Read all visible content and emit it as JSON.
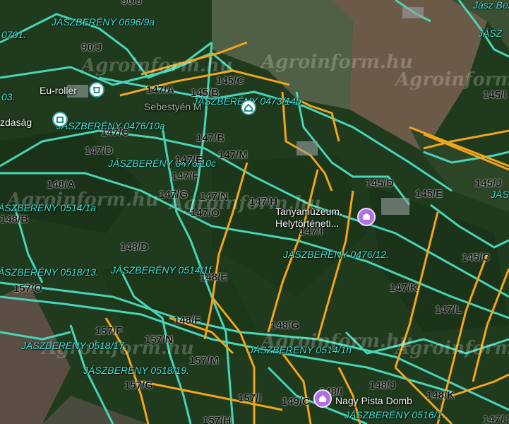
{
  "map": {
    "colors": {
      "forest": "#1f3a1c",
      "field": "#5e6a4e",
      "plowed": "#6b5a48",
      "boundary_cyan": "#49d4b8",
      "boundary_orange": "#f2a51a"
    },
    "watermark": "Agroinform.hu",
    "parcels": [
      "90/J",
      "90/J",
      "147/A",
      "145/C",
      "145/B",
      "147/B",
      "147/M",
      "147/C",
      "147/D",
      "147/E",
      "147/F",
      "147/G",
      "147/N",
      "147/O",
      "147/H",
      "145/D",
      "145/E",
      "145/J",
      "145/I",
      "145/C",
      "147/I",
      "148/A",
      "148/B",
      "148/D",
      "148/E",
      "147/K",
      "147/L",
      "157/O",
      "148/F",
      "148/G",
      "157/F",
      "157/N",
      "157/M",
      "157/G",
      "157/I",
      "149/C",
      "148/I",
      "148/J",
      "148/K",
      "157/H",
      "147/J"
    ],
    "places": [
      {
        "name": "JÁSZBERÉNY 0696/9a"
      },
      {
        "name": "JÁSZBERÉNY 0473/14b"
      },
      {
        "name": "JÁSZBERÉNY 0476/10a"
      },
      {
        "name": "JÁSZBERÉNY 0476/10c"
      },
      {
        "name": "JÁSZBERÉNY 0514/1a"
      },
      {
        "name": "JÁSZBERÉNY 0514/1f"
      },
      {
        "name": "JÁSZBERÉNY 0476/12."
      },
      {
        "name": "JÁSZBERÉNY 0518/13."
      },
      {
        "name": "JÁSZBERÉNY 0518/17."
      },
      {
        "name": "JÁSZBERÉNY 0514/1h"
      },
      {
        "name": "JÁSZBERÉNY 0518/19."
      },
      {
        "name": "JÁSZBERÉNY 0516/1."
      },
      {
        "name": "JÁSZBER"
      },
      {
        "name": "JÁSZ"
      },
      {
        "name": "0701."
      },
      {
        "name": "03."
      },
      {
        "name": "Jász Ber"
      }
    ],
    "pois": {
      "euroller": "Eu-roller",
      "gazdasag": "zdaság",
      "sebestyen": "Sebestyén M",
      "tanyamuzeum": "Tanyamúzeum,",
      "helytorteneti": "Helytörténeti...",
      "nagypista": "Nagy Pista Domb"
    },
    "icons": [
      "shop-pin-icon",
      "business-pin-icon",
      "museum-pin-icon",
      "home-pin-icon"
    ]
  }
}
